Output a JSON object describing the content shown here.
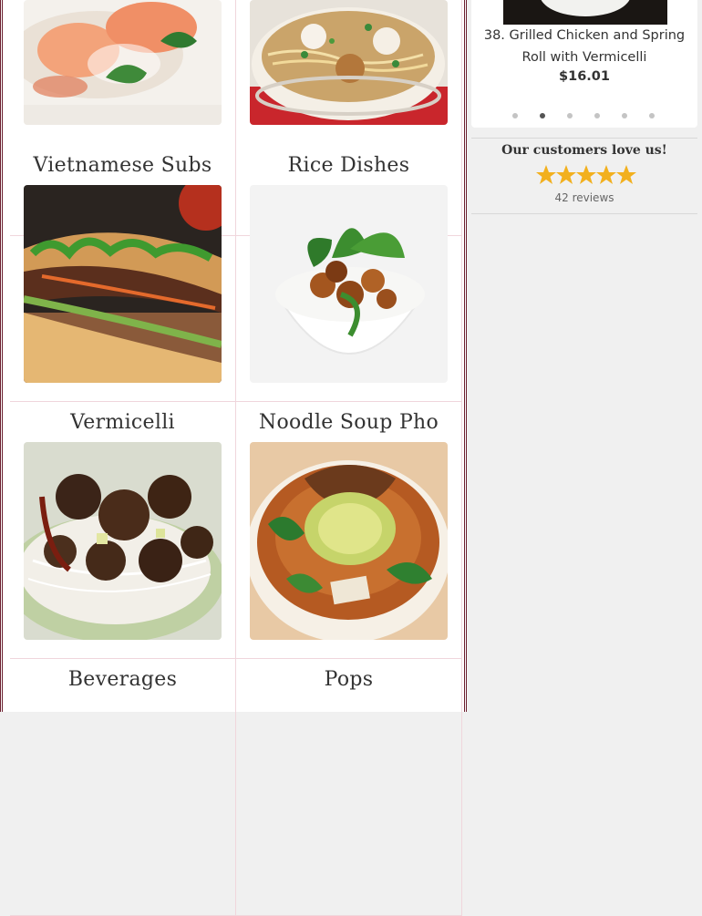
{
  "categories": [
    {
      "label": "",
      "image": "spring-rolls-photo"
    },
    {
      "label": "",
      "image": "wonton-noodle-soup-photo"
    },
    {
      "label": "Vietnamese Subs",
      "image": "banh-mi-sub-photo"
    },
    {
      "label": "Rice Dishes",
      "image": "rice-bowl-photo"
    },
    {
      "label": "Vermicelli",
      "image": "vermicelli-beef-photo"
    },
    {
      "label": "Noodle Soup Pho",
      "image": "pho-soup-photo"
    },
    {
      "label": "Beverages",
      "image": ""
    },
    {
      "label": "Pops",
      "image": ""
    }
  ],
  "carousel": {
    "item_name": "38. Grilled Chicken and Spring Roll with Vermicelli",
    "item_price": "$16.01",
    "dot_count": 6,
    "active_dot": 1
  },
  "reviews": {
    "title": "Our customers love us!",
    "rating": 5,
    "count_text": "42 reviews"
  },
  "colors": {
    "border": "#6b1e2e",
    "star": "#f2b01e",
    "cell_divider": "#f0d6dc"
  }
}
